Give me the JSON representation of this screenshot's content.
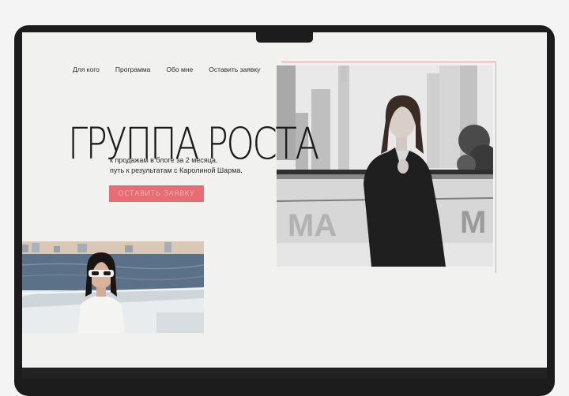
{
  "nav": {
    "items": [
      "Для кого",
      "Программа",
      "Обо мне",
      "Оставить заявку"
    ]
  },
  "hero": {
    "title": "ГРУППА РОСТА",
    "subtitle_line1": "к продажам в блоге за 2 месяца.",
    "subtitle_line2": "путь к результатам с Каролиной Шарма.",
    "cta_label": "ОСТАВИТЬ ЗАЯВКУ",
    "accent_color": "#e96b74"
  },
  "images": {
    "main_photo": "woman-in-blazer-on-yacht-bw-photo",
    "small_photo": "woman-in-sunglasses-on-boat-photo"
  }
}
